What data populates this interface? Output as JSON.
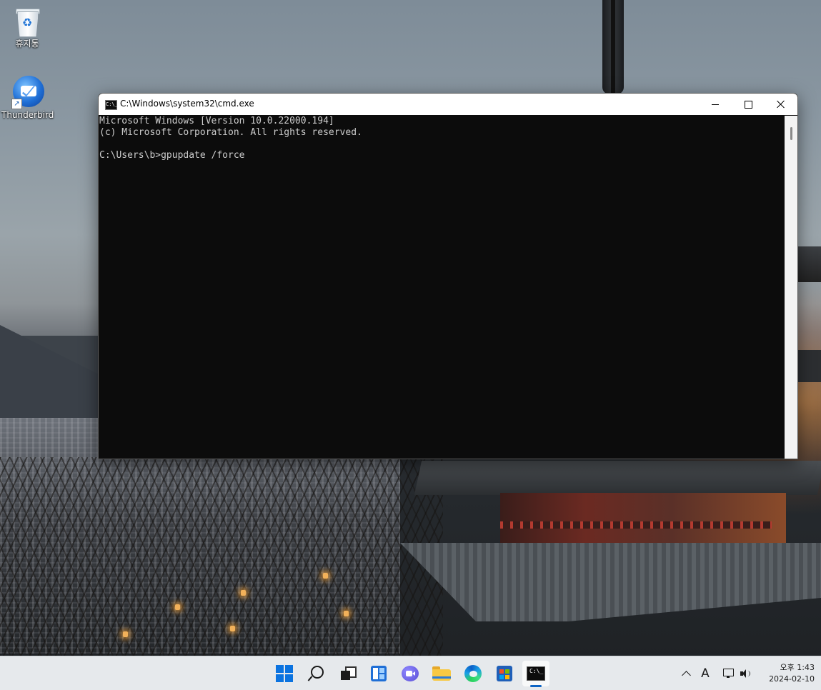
{
  "desktop": {
    "icons": [
      {
        "label": "휴지통",
        "icon": "recycle-bin-icon"
      },
      {
        "label": "Thunderbird",
        "icon": "thunderbird-icon"
      }
    ]
  },
  "cmd_window": {
    "title": "C:\\Windows\\system32\\cmd.exe",
    "icon": "cmd-icon",
    "icon_text": "C:\\_",
    "controls": {
      "minimize": "minimize-icon",
      "maximize": "maximize-icon",
      "close": "close-icon"
    },
    "console_lines": [
      "Microsoft Windows [Version 10.0.22000.194]",
      "(c) Microsoft Corporation. All rights reserved.",
      "",
      "C:\\Users\\b>gpupdate /force"
    ],
    "colors": {
      "background": "#0c0c0c",
      "text": "#cccccc"
    }
  },
  "taskbar": {
    "apps": [
      {
        "name": "start",
        "icon": "windows-start-icon"
      },
      {
        "name": "search",
        "icon": "search-icon"
      },
      {
        "name": "task-view",
        "icon": "task-view-icon"
      },
      {
        "name": "widgets",
        "icon": "widgets-icon"
      },
      {
        "name": "chat",
        "icon": "teams-chat-icon"
      },
      {
        "name": "file-explorer",
        "icon": "folder-icon"
      },
      {
        "name": "edge",
        "icon": "edge-icon"
      },
      {
        "name": "store",
        "icon": "store-icon"
      },
      {
        "name": "command-prompt",
        "icon": "terminal-icon",
        "active": true
      }
    ],
    "tray": {
      "overflow_icon": "chevron-up-icon",
      "ime_indicator": "A",
      "network_icon": "network-icon",
      "volume_icon": "volume-icon",
      "time": "오후 1:43",
      "date": "2024-02-10"
    },
    "accent": "#0b73e0"
  }
}
